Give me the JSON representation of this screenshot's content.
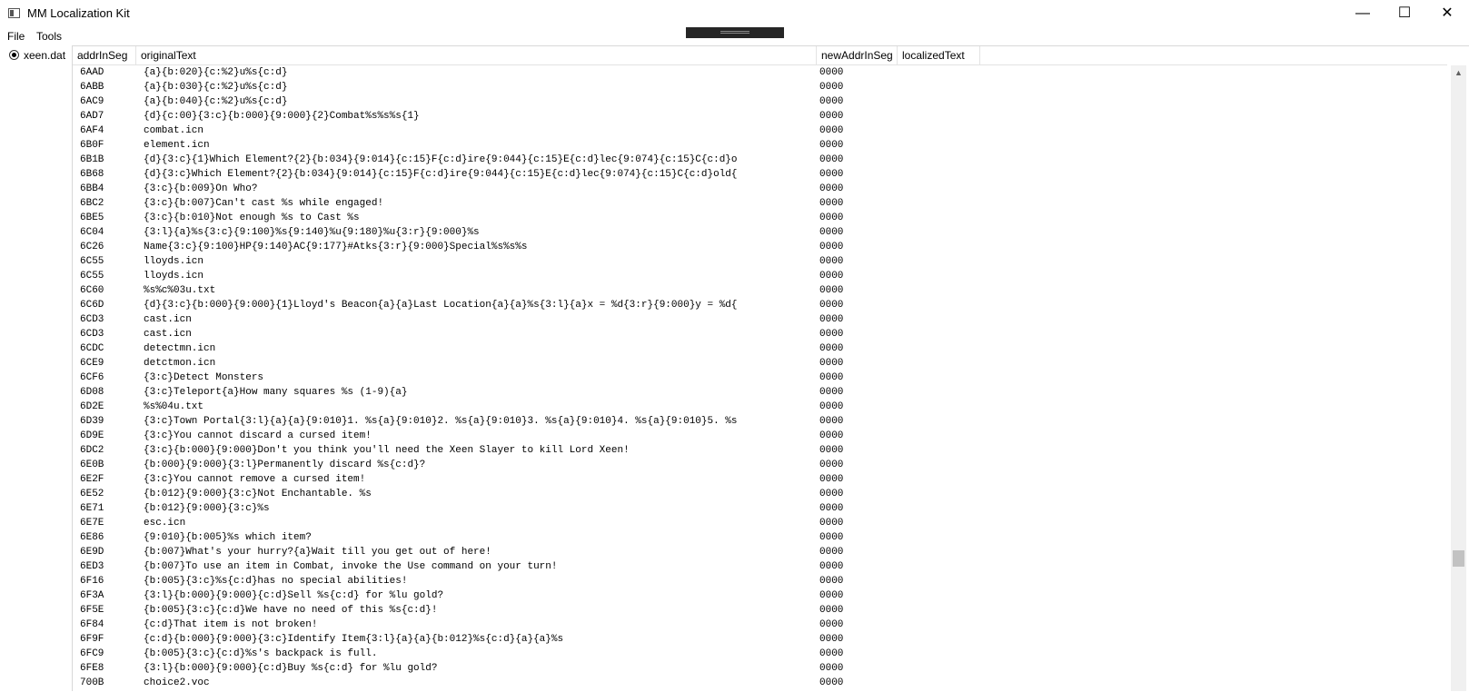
{
  "window": {
    "title": "MM Localization Kit"
  },
  "menu": {
    "file": "File",
    "tools": "Tools"
  },
  "sidebar": {
    "file_label": "xeen.dat"
  },
  "table": {
    "headers": [
      "addrInSeg",
      "originalText",
      "newAddrInSeg",
      "localizedText"
    ],
    "rows": [
      [
        "6AAD",
        "{a}{b:020}{c:%2}u%s{c:d}",
        "0000",
        ""
      ],
      [
        "6ABB",
        "{a}{b:030}{c:%2}u%s{c:d}",
        "0000",
        ""
      ],
      [
        "6AC9",
        "{a}{b:040}{c:%2}u%s{c:d}",
        "0000",
        ""
      ],
      [
        "6AD7",
        "{d}{c:00}{3:c}{b:000}{9:000}{2}Combat%s%s%s{1}",
        "0000",
        ""
      ],
      [
        "6AF4",
        "combat.icn",
        "0000",
        ""
      ],
      [
        "6B0F",
        "element.icn",
        "0000",
        ""
      ],
      [
        "6B1B",
        "{d}{3:c}{1}Which Element?{2}{b:034}{9:014}{c:15}F{c:d}ire{9:044}{c:15}E{c:d}lec{9:074}{c:15}C{c:d}o",
        "0000",
        ""
      ],
      [
        "6B68",
        "{d}{3:c}Which Element?{2}{b:034}{9:014}{c:15}F{c:d}ire{9:044}{c:15}E{c:d}lec{9:074}{c:15}C{c:d}old{",
        "0000",
        ""
      ],
      [
        "6BB4",
        "{3:c}{b:009}On Who?",
        "0000",
        ""
      ],
      [
        "6BC2",
        "{3:c}{b:007}Can't cast %s while engaged!",
        "0000",
        ""
      ],
      [
        "6BE5",
        "{3:c}{b:010}Not enough %s to Cast %s",
        "0000",
        ""
      ],
      [
        "6C04",
        "{3:l}{a}%s{3:c}{9:100}%s{9:140}%u{9:180}%u{3:r}{9:000}%s",
        "0000",
        ""
      ],
      [
        "6C26",
        "Name{3:c}{9:100}HP{9:140}AC{9:177}#Atks{3:r}{9:000}Special%s%s%s",
        "0000",
        ""
      ],
      [
        "6C55",
        "lloyds.icn",
        "0000",
        ""
      ],
      [
        "6C55",
        "lloyds.icn",
        "0000",
        ""
      ],
      [
        "6C60",
        "%s%c%03u.txt",
        "0000",
        ""
      ],
      [
        "6C6D",
        "{d}{3:c}{b:000}{9:000}{1}Lloyd's Beacon{a}{a}Last Location{a}{a}%s{3:l}{a}x = %d{3:r}{9:000}y = %d{",
        "0000",
        ""
      ],
      [
        "6CD3",
        "cast.icn",
        "0000",
        ""
      ],
      [
        "6CD3",
        "cast.icn",
        "0000",
        ""
      ],
      [
        "6CDC",
        "detectmn.icn",
        "0000",
        ""
      ],
      [
        "6CE9",
        "detctmon.icn",
        "0000",
        ""
      ],
      [
        "6CF6",
        "{3:c}Detect Monsters",
        "0000",
        ""
      ],
      [
        "6D08",
        "{3:c}Teleport{a}How many squares %s (1-9){a}",
        "0000",
        ""
      ],
      [
        "6D2E",
        "%s%04u.txt",
        "0000",
        ""
      ],
      [
        "6D39",
        "{3:c}Town Portal{3:l}{a}{a}{9:010}1. %s{a}{9:010}2. %s{a}{9:010}3. %s{a}{9:010}4. %s{a}{9:010}5. %s",
        "0000",
        ""
      ],
      [
        "6D9E",
        "{3:c}You cannot discard a cursed item!",
        "0000",
        ""
      ],
      [
        "6DC2",
        "{3:c}{b:000}{9:000}Don't you think you'll need the Xeen Slayer to kill Lord Xeen!",
        "0000",
        ""
      ],
      [
        "6E0B",
        "{b:000}{9:000}{3:l}Permanently discard %s{c:d}?",
        "0000",
        ""
      ],
      [
        "6E2F",
        "{3:c}You cannot remove a cursed item!",
        "0000",
        ""
      ],
      [
        "6E52",
        "{b:012}{9:000}{3:c}Not Enchantable.  %s",
        "0000",
        ""
      ],
      [
        "6E71",
        "{b:012}{9:000}{3:c}%s",
        "0000",
        ""
      ],
      [
        "6E7E",
        "esc.icn",
        "0000",
        ""
      ],
      [
        "6E86",
        "{9:010}{b:005}%s which item?",
        "0000",
        ""
      ],
      [
        "6E9D",
        "{b:007}What's your hurry?{a}Wait till you get out of here!",
        "0000",
        ""
      ],
      [
        "6ED3",
        "{b:007}To use an item in Combat, invoke the Use command on your turn!",
        "0000",
        ""
      ],
      [
        "6F16",
        "{b:005}{3:c}%s{c:d}has no special abilities!",
        "0000",
        ""
      ],
      [
        "6F3A",
        "{3:l}{b:000}{9:000}{c:d}Sell %s{c:d} for %lu gold?",
        "0000",
        ""
      ],
      [
        "6F5E",
        "{b:005}{3:c}{c:d}We have no need of this %s{c:d}!",
        "0000",
        ""
      ],
      [
        "6F84",
        "{c:d}That item is not broken!",
        "0000",
        ""
      ],
      [
        "6F9F",
        "{c:d}{b:000}{9:000}{3:c}Identify Item{3:l}{a}{a}{b:012}%s{c:d}{a}{a}%s",
        "0000",
        ""
      ],
      [
        "6FC9",
        "{b:005}{3:c}{c:d}%s's backpack is full.",
        "0000",
        ""
      ],
      [
        "6FE8",
        "{3:l}{b:000}{9:000}{c:d}Buy %s{c:d} for %lu gold?",
        "0000",
        ""
      ],
      [
        "700B",
        "choice2.voc",
        "0000",
        ""
      ]
    ]
  },
  "icons": {
    "app": "app-window-icon",
    "minimize": "minimize-icon",
    "maximize": "maximize-icon",
    "close": "close-icon",
    "scroll_up": "chevron-up-icon"
  },
  "glyphs": {
    "minimize": "—",
    "maximize": "☐",
    "close": "✕",
    "scroll_up": "▲"
  }
}
